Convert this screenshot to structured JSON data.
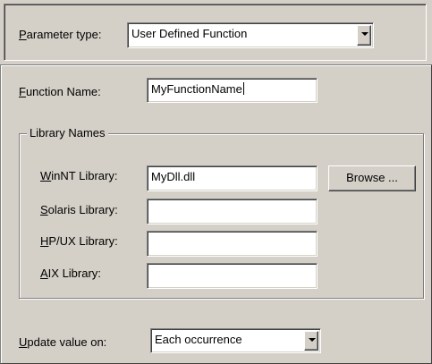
{
  "parameter_type": {
    "label_accel": "P",
    "label_rest": "arameter type:",
    "value": "User Defined Function"
  },
  "function_name": {
    "label_accel": "F",
    "label_rest": "unction Name:",
    "value": "MyFunctionName"
  },
  "library_names": {
    "title": "Library Names",
    "winnt": {
      "label_accel": "W",
      "label_rest": "inNT Library:",
      "value": "MyDll.dll"
    },
    "solaris": {
      "label_accel": "S",
      "label_rest": "olaris Library:",
      "value": ""
    },
    "hpux": {
      "label_accel": "H",
      "label_rest": "P/UX Library:",
      "value": ""
    },
    "aix": {
      "label_accel": "A",
      "label_rest": "IX Library:",
      "value": ""
    },
    "browse_label": "Browse ..."
  },
  "update_value": {
    "label_accel": "U",
    "label_rest": "pdate value on:",
    "value": "Each occurrence"
  },
  "icons": {
    "dropdown_arrow": "chevron-down-icon"
  }
}
